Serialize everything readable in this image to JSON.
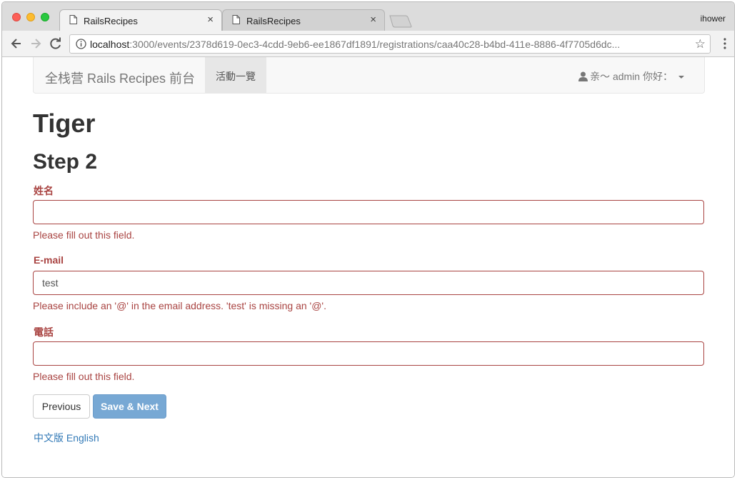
{
  "browser": {
    "tabs": [
      {
        "title": "RailsRecipes",
        "active": true
      },
      {
        "title": "RailsRecipes",
        "active": false
      }
    ],
    "profile": "ihower",
    "url_host": "localhost",
    "url_rest": ":3000/events/2378d619-0ec3-4cdd-9eb6-ee1867df1891/registrations/caa40c28-b4bd-411e-8886-4f7705d6dc...",
    "tab_close_glyph": "×",
    "star_glyph": "☆"
  },
  "navbar": {
    "brand": "全栈营 Rails Recipes 前台",
    "active_item": "活動一覽",
    "user_menu": "亲～ admin 你好："
  },
  "page": {
    "title": "Tiger",
    "step": "Step 2"
  },
  "form": {
    "name": {
      "label": "姓名",
      "value": "",
      "error": "Please fill out this field."
    },
    "email": {
      "label": "E-mail",
      "value": "test",
      "error": "Please include an '@' in the email address. 'test' is missing an '@'."
    },
    "phone": {
      "label": "電話",
      "value": "",
      "error": "Please fill out this field."
    },
    "previous_label": "Previous",
    "save_next_label": "Save & Next"
  },
  "footer": {
    "lang_zh": "中文版",
    "lang_en": "English"
  },
  "colors": {
    "error": "#a94442",
    "link": "#337ab7",
    "primary_disabled": "#77a8d4"
  },
  "icons": [
    "document-icon",
    "back-arrow-icon",
    "forward-arrow-icon",
    "reload-icon",
    "info-icon",
    "star-icon",
    "menu-dots-icon",
    "user-icon",
    "caret-down-icon",
    "close-icon"
  ]
}
